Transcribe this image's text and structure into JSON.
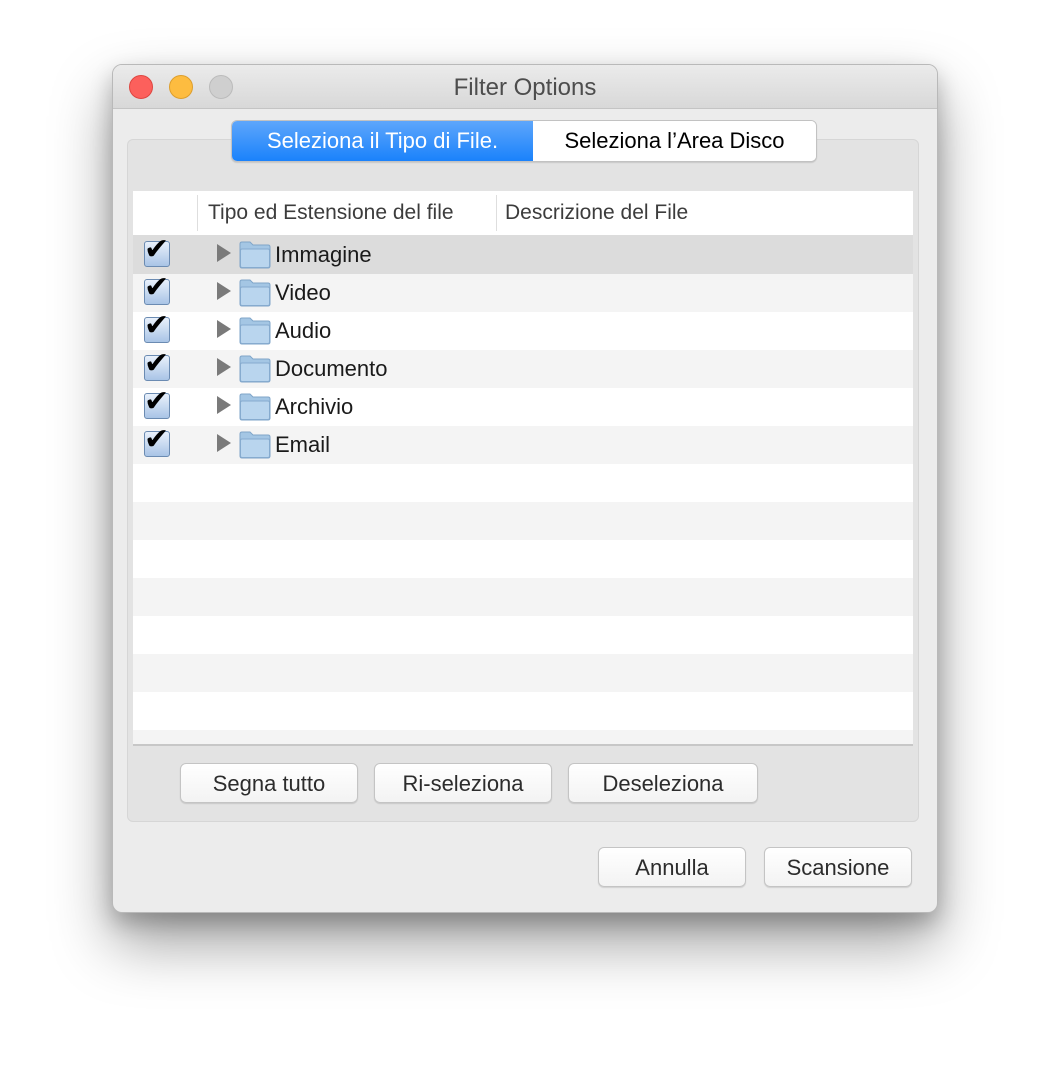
{
  "window": {
    "title": "Filter Options"
  },
  "tabs": [
    {
      "label": "Seleziona il Tipo di File.",
      "active": true
    },
    {
      "label": "Seleziona l’Area Disco",
      "active": false
    }
  ],
  "table": {
    "columns": [
      "Tipo ed Estensione del file",
      "Descrizione del File"
    ],
    "rows": [
      {
        "label": "Immagine",
        "checked": true,
        "description": ""
      },
      {
        "label": "Video",
        "checked": true,
        "description": ""
      },
      {
        "label": "Audio",
        "checked": true,
        "description": ""
      },
      {
        "label": "Documento",
        "checked": true,
        "description": ""
      },
      {
        "label": "Archivio",
        "checked": true,
        "description": ""
      },
      {
        "label": "Email",
        "checked": true,
        "description": ""
      }
    ],
    "checkmark_glyph": "✔"
  },
  "selection_buttons": {
    "mark_all": "Segna tutto",
    "reselect": "Ri-seleziona",
    "deselect": "Deseleziona"
  },
  "dialog_buttons": {
    "cancel": "Annulla",
    "scan": "Scansione"
  },
  "colors": {
    "accent": "#1a82fb",
    "close": "#fc605c",
    "minimize": "#fdbc40",
    "zoom_disabled": "#cfcfcf"
  }
}
